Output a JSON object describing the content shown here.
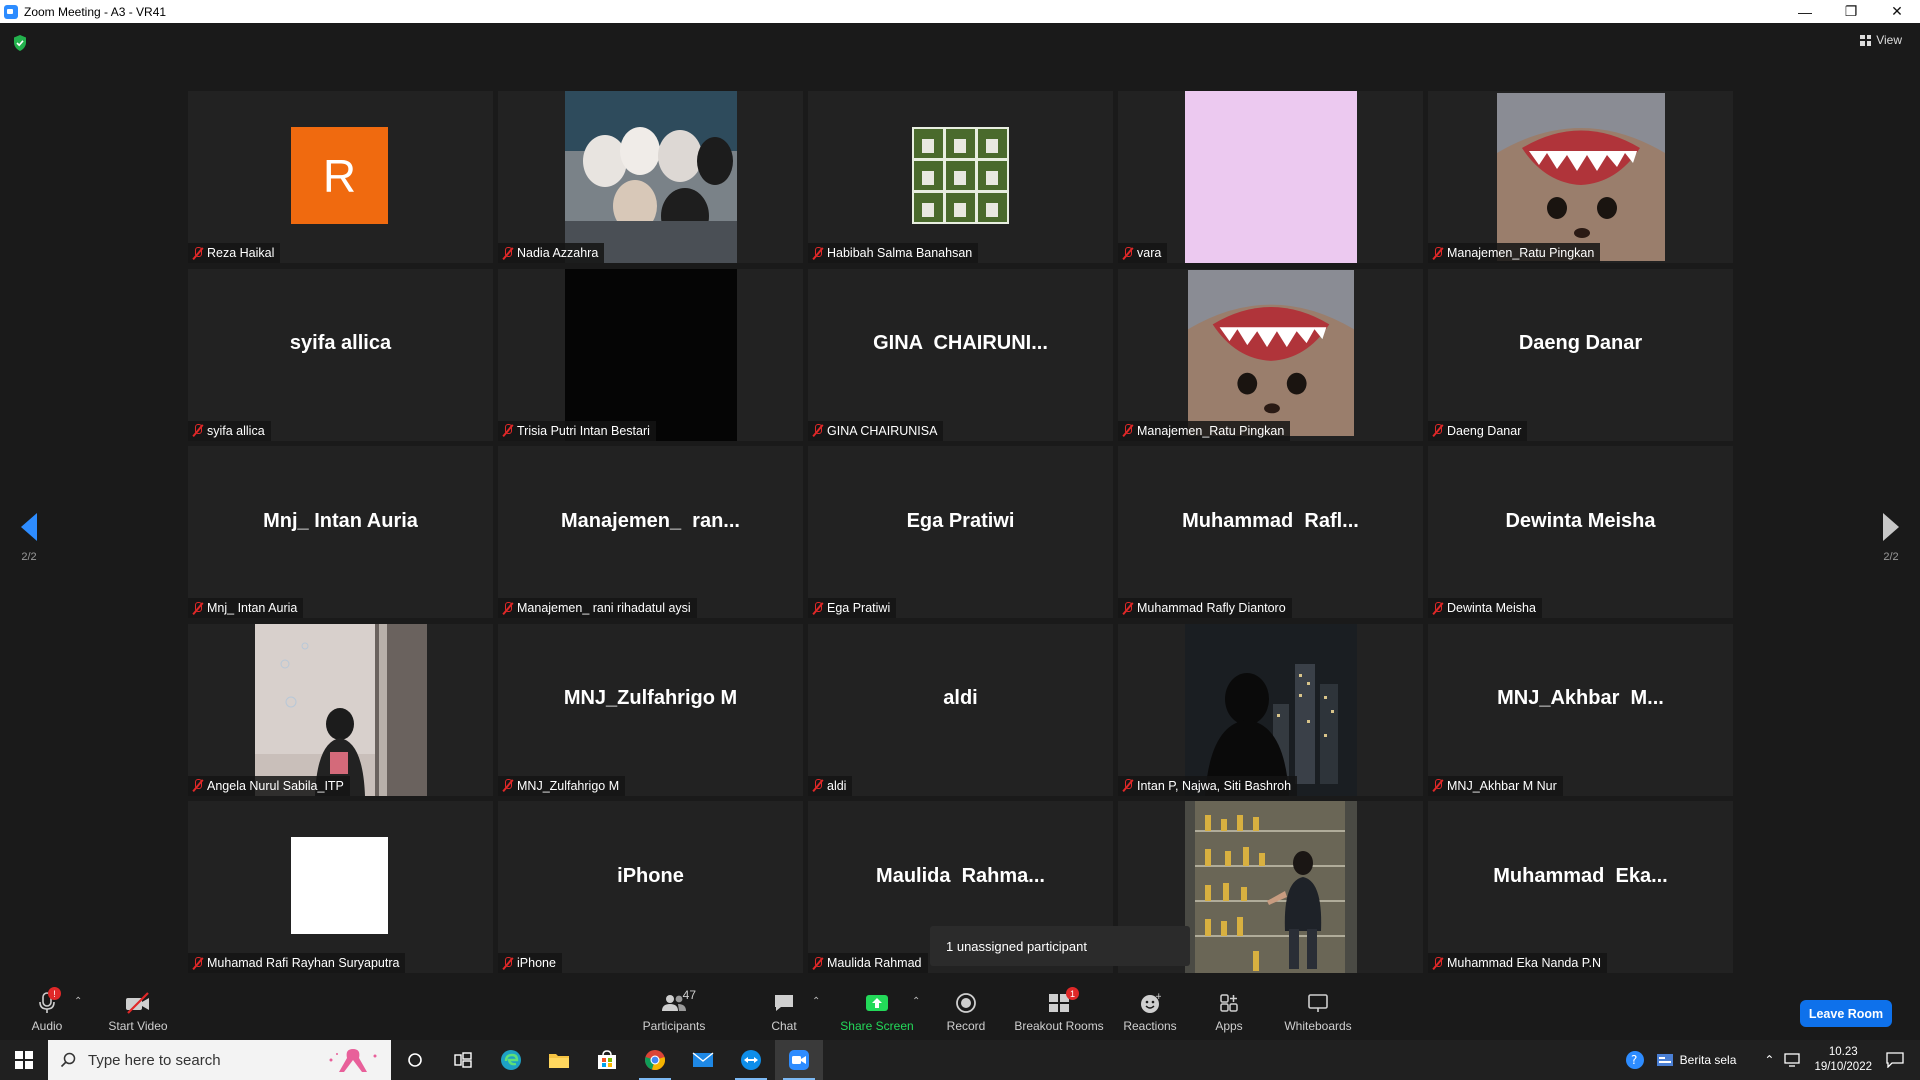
{
  "window": {
    "title": "Zoom Meeting - A3 - VR41"
  },
  "meeting": {
    "view_label": "View",
    "page_indicator": "2/2",
    "tooltip": "1 unassigned participant"
  },
  "tiles": [
    {
      "label": "Reza Haikal",
      "display": "R"
    },
    {
      "label": "Nadia Azzahra",
      "display": ""
    },
    {
      "label": "Habibah Salma Banahsan",
      "display": ""
    },
    {
      "label": "vara",
      "display": ""
    },
    {
      "label": "Manajemen_Ratu Pingkan",
      "display": ""
    },
    {
      "label": "syifa allica",
      "display": "syifa allica"
    },
    {
      "label": "Trisia Putri Intan Bestari",
      "display": ""
    },
    {
      "label": "GINA CHAIRUNISA",
      "display": "GINA  CHAIRUNI..."
    },
    {
      "label": "Manajemen_Ratu Pingkan",
      "display": ""
    },
    {
      "label": "Daeng Danar",
      "display": "Daeng Danar"
    },
    {
      "label": "Mnj_ Intan Auria",
      "display": "Mnj_ Intan Auria"
    },
    {
      "label": "Manajemen_ rani rihadatul aysi",
      "display": "Manajemen_  ran..."
    },
    {
      "label": "Ega Pratiwi",
      "display": "Ega Pratiwi"
    },
    {
      "label": "Muhammad Rafly Diantoro",
      "display": "Muhammad  Rafl..."
    },
    {
      "label": "Dewinta Meisha",
      "display": "Dewinta Meisha"
    },
    {
      "label": "Angela Nurul Sabila_ITP",
      "display": ""
    },
    {
      "label": "MNJ_Zulfahrigo M",
      "display": "MNJ_Zulfahrigo M"
    },
    {
      "label": "aldi",
      "display": "aldi"
    },
    {
      "label": "Intan P, Najwa, Siti Bashroh",
      "display": ""
    },
    {
      "label": "MNJ_Akhbar M Nur",
      "display": "MNJ_Akhbar  M..."
    },
    {
      "label": "Muhamad Rafi Rayhan Suryaputra",
      "display": ""
    },
    {
      "label": "iPhone",
      "display": "iPhone"
    },
    {
      "label": "Maulida Rahmad",
      "display": "Maulida  Rahma..."
    },
    {
      "label": "",
      "display": ""
    },
    {
      "label": "Muhammad Eka Nanda P.N",
      "display": "Muhammad  Eka..."
    }
  ],
  "toolbar": {
    "audio": "Audio",
    "start_video": "Start Video",
    "participants": "Participants",
    "participants_count": "47",
    "chat": "Chat",
    "share_screen": "Share Screen",
    "record": "Record",
    "breakout_rooms": "Breakout Rooms",
    "breakout_badge": "1",
    "reactions": "Reactions",
    "apps": "Apps",
    "whiteboards": "Whiteboards",
    "leave_room": "Leave Room",
    "audio_badge": "!"
  },
  "taskbar": {
    "search_placeholder": "Type here to search",
    "news": "Berita sela",
    "time": "10.23",
    "date": "19/10/2022"
  },
  "colors": {
    "accent": "#2d8cff",
    "leave": "#0e71eb",
    "muted": "#e02828",
    "avatar_orange": "#f06a0f",
    "share_green": "#23d959"
  }
}
